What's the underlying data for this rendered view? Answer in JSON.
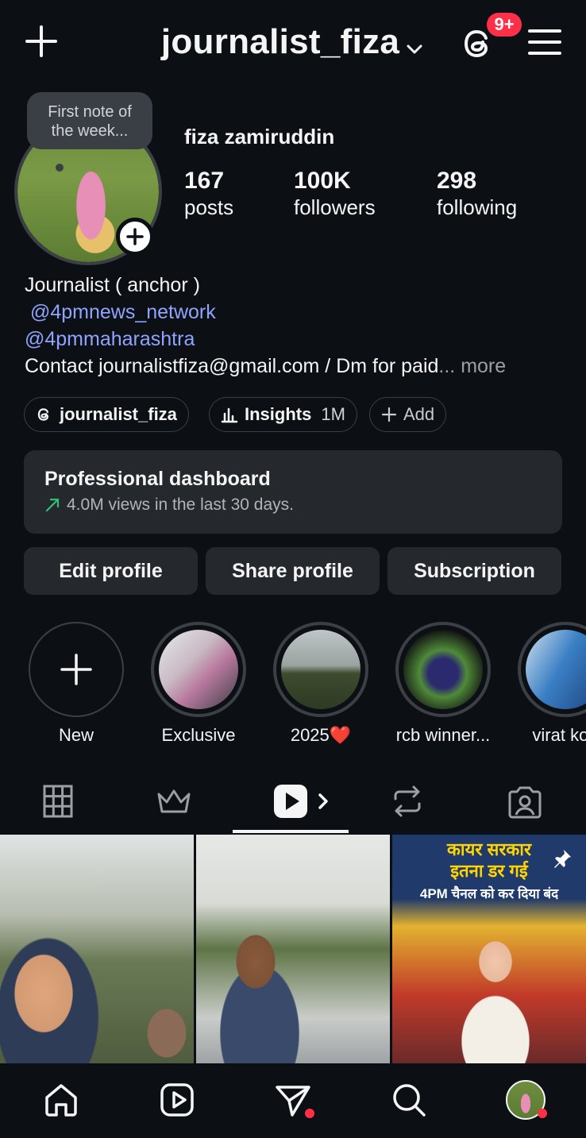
{
  "header": {
    "username": "journalist_fiza",
    "notification_badge": "9+"
  },
  "note": {
    "text_line1": "First note of",
    "text_line2": "the week..."
  },
  "profile": {
    "display_name": "fiza zamiruddin",
    "stats": [
      {
        "value": "167",
        "label": "posts"
      },
      {
        "value": "100K",
        "label": "followers"
      },
      {
        "value": "298",
        "label": "following"
      }
    ]
  },
  "bio": {
    "line1": "Journalist ( anchor )",
    "mention1": " @4pmnews_network",
    "mention2": "@4pmmaharashtra",
    "line4": "Contact journalistfiza@gmail.com / Dm for paid",
    "more": "... more"
  },
  "pills": {
    "threads_handle": "journalist_fiza",
    "insights_label": "Insights",
    "insights_value": "1M",
    "add_label": "Add"
  },
  "dashboard": {
    "title": "Professional dashboard",
    "subtitle": "4.0M views in the last 30 days."
  },
  "actions": {
    "edit": "Edit profile",
    "share": "Share profile",
    "subscription": "Subscription"
  },
  "highlights": [
    {
      "label": "New"
    },
    {
      "label": "Exclusive"
    },
    {
      "label": "2025❤️"
    },
    {
      "label": "rcb winner..."
    },
    {
      "label": "virat koh"
    }
  ],
  "grid": {
    "tile3_line1": "कायर सरकार",
    "tile3_line2": "इतना डर गई",
    "tile3_line3": "4PM चैनल को कर दिया बंद"
  },
  "colors": {
    "background": "#0c1014",
    "surface": "#25292e",
    "link": "#8fa4ff",
    "badge": "#ff2f4a",
    "trend": "#2fbf71"
  }
}
